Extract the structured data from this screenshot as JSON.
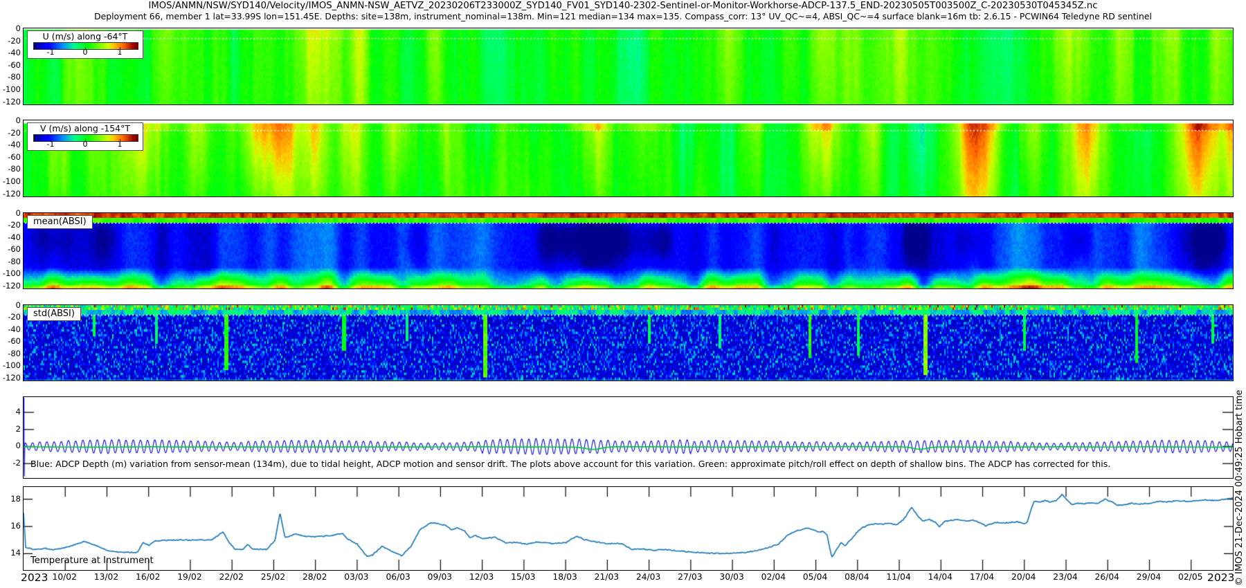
{
  "header": {
    "line1": "IMOS/ANMN/NSW/SYD140/Velocity/IMOS_ANMN-NSW_AETVZ_20230206T233000Z_SYD140_FV01_SYD140-2302-Sentinel-or-Monitor-Workhorse-ADCP-137.5_END-20230505T003500Z_C-20230530T045345Z.nc",
    "line2": "Deployment 66, member 1 lat=33.99S lon=151.45E. Depths: site=138m, instrument_nominal=138m. Min=121 median=134 max=135. Compass_corr: 13° UV_QC~=4, ABSI_QC~=4 surface blank=16m tb: 2.6.15 - PCWIN64 Teledyne RD sentinel"
  },
  "copyright": "© IMOS 21-Dec-2024 00:49:25 Hobart time",
  "x_axis": {
    "year_left": "2023",
    "year_right": "2023",
    "span_days": 87,
    "start_date_label": "2023",
    "tick_days": [
      3,
      6,
      9,
      12,
      15,
      18,
      21,
      24,
      27,
      30,
      33,
      36,
      39,
      42,
      45,
      48,
      51,
      54,
      57,
      60,
      63,
      66,
      69,
      72,
      75,
      78,
      81,
      84
    ],
    "tick_labels": [
      "10/02",
      "13/02",
      "16/02",
      "19/02",
      "22/02",
      "25/02",
      "28/02",
      "03/03",
      "06/03",
      "09/03",
      "12/03",
      "15/03",
      "18/03",
      "21/03",
      "24/03",
      "27/03",
      "30/03",
      "02/04",
      "05/04",
      "08/04",
      "11/04",
      "14/04",
      "17/04",
      "20/04",
      "23/04",
      "26/04",
      "29/04",
      "02/05"
    ]
  },
  "chart_data": [
    {
      "id": "u_velocity",
      "type": "heatmap",
      "label": "U (m/s) along -64°T",
      "colormap": "jet",
      "clim": [
        -1.5,
        1.5
      ],
      "colorbar_ticks": [
        -1,
        0,
        1
      ],
      "depth_ticks": [
        0,
        -20,
        -40,
        -60,
        -80,
        -100,
        -120
      ],
      "depth_range_m": [
        0,
        125
      ],
      "surface_blank_m": 16,
      "render": {
        "kind": "uv",
        "seed": 7,
        "base": 0.07,
        "amps": [
          0.2,
          0.13,
          0.1
        ],
        "jitter": 0.11,
        "depth_fade": 0.35,
        "surface_boost": 0.1,
        "top_blank_m": 2,
        "events": [
          [
            4,
            0.8,
            0.3
          ],
          [
            10,
            1,
            0.35
          ],
          [
            15,
            0.7,
            -0.22
          ],
          [
            20.8,
            1.6,
            0.5
          ],
          [
            24,
            0.8,
            0.3
          ],
          [
            29.5,
            0.8,
            0.38
          ],
          [
            33.5,
            0.9,
            -0.25
          ],
          [
            38,
            0.8,
            0.25
          ],
          [
            44,
            0.9,
            -0.22
          ],
          [
            50.5,
            1,
            0.42
          ],
          [
            55,
            0.7,
            0.3
          ],
          [
            57.5,
            1.2,
            0.5
          ],
          [
            63,
            0.8,
            0.35
          ],
          [
            67,
            0.8,
            0.25
          ],
          [
            70.5,
            1,
            -0.25
          ],
          [
            75.5,
            2,
            0.55
          ],
          [
            79,
            0.8,
            0.3
          ],
          [
            82.5,
            0.8,
            0.4
          ],
          [
            86,
            0.8,
            0.3
          ]
        ]
      }
    },
    {
      "id": "v_velocity",
      "type": "heatmap",
      "label": "V (m/s) along -154°T",
      "colormap": "jet",
      "clim": [
        -1.5,
        1.5
      ],
      "colorbar_ticks": [
        -1,
        0,
        1
      ],
      "depth_ticks": [
        0,
        -20,
        -40,
        -60,
        -80,
        -100,
        -120
      ],
      "depth_range_m": [
        0,
        125
      ],
      "surface_blank_m": 16,
      "render": {
        "kind": "uv",
        "seed": 13,
        "base": 0.1,
        "amps": [
          0.28,
          0.15,
          0.1
        ],
        "jitter": 0.11,
        "depth_fade": 0.55,
        "surface_boost": 0.3,
        "top_blank_m": 5,
        "events": [
          [
            2.5,
            1,
            0.45
          ],
          [
            5,
            0.8,
            0.35
          ],
          [
            8.5,
            1.5,
            0.75
          ],
          [
            12.5,
            1,
            0.6
          ],
          [
            17.6,
            2.2,
            1.15
          ],
          [
            21,
            0.8,
            0.55
          ],
          [
            23.5,
            1,
            0.6
          ],
          [
            27,
            1.2,
            0.7
          ],
          [
            30,
            0.8,
            0.4
          ],
          [
            33,
            1.2,
            -0.5
          ],
          [
            36.5,
            1,
            -0.3
          ],
          [
            41,
            1.2,
            0.65
          ],
          [
            44.5,
            1,
            0.3
          ],
          [
            48,
            1.2,
            -0.4
          ],
          [
            52.5,
            1,
            0.45
          ],
          [
            57.5,
            1.5,
            0.85
          ],
          [
            61,
            0.8,
            0.5
          ],
          [
            64.5,
            1.2,
            -0.45
          ],
          [
            68.5,
            1.5,
            0.8
          ],
          [
            72.5,
            1.2,
            0.55
          ],
          [
            76.5,
            1.2,
            0.7
          ],
          [
            80.5,
            0.8,
            -0.3
          ],
          [
            84.5,
            1.5,
            0.85
          ],
          [
            87,
            1,
            0.6
          ]
        ]
      }
    },
    {
      "id": "mean_absi",
      "type": "heatmap",
      "label": "mean(ABSI)",
      "colormap": "jet",
      "depth_ticks": [
        0,
        -20,
        -40,
        -60,
        -80,
        -100,
        -120
      ],
      "depth_range_m": [
        0,
        125
      ],
      "surface_blank_m": 16,
      "render": {
        "kind": "mean",
        "seed": 21
      }
    },
    {
      "id": "std_absi",
      "type": "heatmap",
      "label": "std(ABSI)",
      "colormap": "jet",
      "depth_ticks": [
        0,
        -20,
        -40,
        -60,
        -80,
        -100,
        -120
      ],
      "depth_range_m": [
        0,
        125
      ],
      "surface_blank_m": 16,
      "render": {
        "kind": "std",
        "seed": 29,
        "bright_lines": [
          [
            5,
            0.1,
            0.4,
            0.4
          ],
          [
            9.5,
            0.1,
            0.35,
            0.5
          ],
          [
            14.5,
            0.15,
            0.5,
            0.85
          ],
          [
            23,
            0.12,
            0.45,
            0.6
          ],
          [
            27.5,
            0.1,
            0.35,
            0.45
          ],
          [
            33.2,
            0.15,
            0.55,
            0.95
          ],
          [
            45,
            0.1,
            0.4,
            0.5
          ],
          [
            50,
            0.1,
            0.35,
            0.55
          ],
          [
            56.5,
            0.12,
            0.5,
            0.7
          ],
          [
            60,
            0.1,
            0.4,
            0.65
          ],
          [
            64.8,
            0.15,
            0.6,
            0.9
          ],
          [
            72,
            0.1,
            0.4,
            0.6
          ],
          [
            80,
            0.12,
            0.45,
            0.75
          ],
          [
            85.5,
            0.1,
            0.4,
            0.5
          ]
        ]
      }
    },
    {
      "id": "depth_variation",
      "type": "line",
      "annotation": "Blue: ADCP Depth (m) variation from sensor-mean (134m), due to tidal height, ADCP motion and sensor drift. The plots above account for this variation. Green: approximate pitch/roll effect on depth of shallow bins. The ADCP has corrected for this.",
      "yticks": [
        4,
        2,
        0,
        -2
      ],
      "ylim": [
        5.8,
        -3.7
      ],
      "series": [
        {
          "name": "adcp-depth-variation",
          "color": "#0000dd",
          "tidal": {
            "period_days": 0.5175,
            "amp_base": 0.42,
            "amp_mod": 0.3,
            "spring_neap_days": 14.8,
            "boost_window": [
              33,
              48,
              0.18
            ],
            "start_spike": [
              5.75,
              -3.5
            ]
          }
        },
        {
          "name": "pitch-roll-effect",
          "color": "#00c832",
          "base": -0.05,
          "dips": [
            [
              41,
              0.8,
              0.3
            ],
            [
              64.5,
              0.7,
              0.28
            ]
          ]
        }
      ]
    },
    {
      "id": "temperature",
      "type": "line",
      "label": "Temperature at Instrument",
      "yticks": [
        18,
        16,
        14
      ],
      "ylim": [
        18.9,
        12.8
      ],
      "series": [
        {
          "name": "temperature-at-instrument",
          "color": "#1f77b4",
          "points": [
            [
              0,
              17.0
            ],
            [
              0.15,
              14.45
            ],
            [
              0.8,
              14.3
            ],
            [
              1.5,
              14.4
            ],
            [
              2.2,
              14.3
            ],
            [
              3,
              14.45
            ],
            [
              3.8,
              14.7
            ],
            [
              4.4,
              14.9
            ],
            [
              5.2,
              14.6
            ],
            [
              6,
              14.25
            ],
            [
              7,
              14.1
            ],
            [
              8.2,
              14.1
            ],
            [
              8.6,
              14.85
            ],
            [
              9,
              14.6
            ],
            [
              9.5,
              14.95
            ],
            [
              10.5,
              15.0
            ],
            [
              12,
              15.0
            ],
            [
              13.5,
              15.0
            ],
            [
              14.35,
              15.6
            ],
            [
              14.8,
              14.8
            ],
            [
              15.2,
              14.35
            ],
            [
              15.8,
              14.3
            ],
            [
              16.1,
              14.7
            ],
            [
              16.5,
              14.35
            ],
            [
              17.5,
              14.3
            ],
            [
              18.1,
              15.0
            ],
            [
              18.45,
              17.0
            ],
            [
              18.8,
              15.2
            ],
            [
              19.6,
              15.45
            ],
            [
              20.1,
              15.3
            ],
            [
              21,
              15.25
            ],
            [
              22,
              15.3
            ],
            [
              22.9,
              15.5
            ],
            [
              23.3,
              15.1
            ],
            [
              24,
              14.7
            ],
            [
              24.7,
              13.8
            ],
            [
              25.1,
              13.9
            ],
            [
              25.8,
              14.55
            ],
            [
              26.6,
              14.1
            ],
            [
              27.2,
              13.85
            ],
            [
              27.9,
              14.55
            ],
            [
              28.5,
              15.75
            ],
            [
              29.3,
              16.3
            ],
            [
              29.9,
              16.2
            ],
            [
              30.4,
              16.05
            ],
            [
              30.8,
              15.75
            ],
            [
              31.2,
              15.9
            ],
            [
              31.7,
              15.7
            ],
            [
              32.1,
              15.2
            ],
            [
              32.5,
              15.35
            ],
            [
              33,
              15.1
            ],
            [
              33.9,
              15.2
            ],
            [
              34.7,
              14.8
            ],
            [
              35.4,
              14.85
            ],
            [
              36.2,
              14.7
            ],
            [
              37,
              14.85
            ],
            [
              38,
              14.75
            ],
            [
              39,
              14.8
            ],
            [
              39.8,
              15.3
            ],
            [
              40.3,
              15.05
            ],
            [
              41,
              14.9
            ],
            [
              42,
              14.75
            ],
            [
              43,
              14.75
            ],
            [
              43.8,
              14.3
            ],
            [
              44.5,
              14.35
            ],
            [
              45.3,
              14.25
            ],
            [
              46.2,
              14.3
            ],
            [
              47.2,
              14.2
            ],
            [
              48.2,
              14.1
            ],
            [
              49.2,
              14.05
            ],
            [
              50.2,
              14.0
            ],
            [
              51.2,
              14.05
            ],
            [
              52,
              14.1
            ],
            [
              52.8,
              14.25
            ],
            [
              53.6,
              14.45
            ],
            [
              54.3,
              14.7
            ],
            [
              54.9,
              15.3
            ],
            [
              55.4,
              15.6
            ],
            [
              55.9,
              15.75
            ],
            [
              56.3,
              15.9
            ],
            [
              56.7,
              15.8
            ],
            [
              57.2,
              15.6
            ],
            [
              57.5,
              15.65
            ],
            [
              57.8,
              15.4
            ],
            [
              58.0,
              14.4
            ],
            [
              58.15,
              13.75
            ],
            [
              58.5,
              14.3
            ],
            [
              58.8,
              14.8
            ],
            [
              59.1,
              14.6
            ],
            [
              59.5,
              15.0
            ],
            [
              59.9,
              15.5
            ],
            [
              60.3,
              15.9
            ],
            [
              60.8,
              16.1
            ],
            [
              61.3,
              16.2
            ],
            [
              61.8,
              16.15
            ],
            [
              62.3,
              16.25
            ],
            [
              62.8,
              16.1
            ],
            [
              63.3,
              16.5
            ],
            [
              63.9,
              17.4
            ],
            [
              64.3,
              16.8
            ],
            [
              64.7,
              16.4
            ],
            [
              65.2,
              16.5
            ],
            [
              65.6,
              16.3
            ],
            [
              65.9,
              16.0
            ],
            [
              66.3,
              16.4
            ],
            [
              66.8,
              16.45
            ],
            [
              67.3,
              16.5
            ],
            [
              67.8,
              16.4
            ],
            [
              68.3,
              16.45
            ],
            [
              68.8,
              16.3
            ],
            [
              69.2,
              16.05
            ],
            [
              69.6,
              16.2
            ],
            [
              70,
              16.3
            ],
            [
              70.5,
              16.25
            ],
            [
              71,
              16.3
            ],
            [
              71.5,
              16.35
            ],
            [
              71.9,
              16.2
            ],
            [
              72.2,
              16.3
            ],
            [
              72.5,
              17.3
            ],
            [
              72.7,
              17.85
            ],
            [
              73.1,
              17.8
            ],
            [
              73.5,
              17.9
            ],
            [
              73.9,
              17.8
            ],
            [
              74.3,
              17.9
            ],
            [
              74.7,
              18.35
            ],
            [
              75.1,
              17.9
            ],
            [
              75.4,
              17.6
            ],
            [
              75.8,
              17.7
            ],
            [
              76.3,
              17.65
            ],
            [
              76.8,
              17.75
            ],
            [
              77.3,
              17.7
            ],
            [
              77.8,
              18.0
            ],
            [
              78.3,
              17.8
            ],
            [
              78.7,
              17.55
            ],
            [
              79.2,
              17.6
            ],
            [
              79.7,
              17.7
            ],
            [
              80.3,
              17.65
            ],
            [
              81,
              17.7
            ],
            [
              81.7,
              17.85
            ],
            [
              82.3,
              17.8
            ],
            [
              83,
              17.9
            ],
            [
              83.7,
              17.85
            ],
            [
              84.4,
              17.9
            ],
            [
              85.1,
              17.95
            ],
            [
              85.8,
              17.9
            ],
            [
              86.4,
              18.0
            ],
            [
              87,
              18.1
            ]
          ]
        }
      ]
    }
  ]
}
